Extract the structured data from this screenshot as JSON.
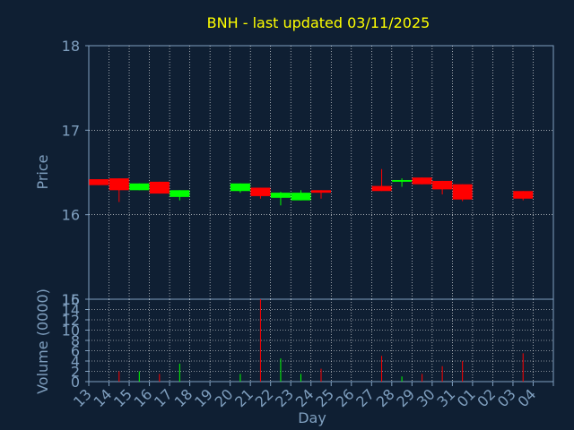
{
  "chart_data": [
    {
      "type": "candlestick",
      "title": "BNH - last updated 03/11/2025",
      "ylabel": "Price",
      "ylim": [
        15,
        18
      ],
      "yticks": [
        "18",
        "17",
        "16",
        "15"
      ],
      "grid": true,
      "colors": {
        "up": "#00ff00",
        "down": "#ff0000",
        "title": "#ffff00",
        "axis_text": "#7f9fbf",
        "background": "#0f1f33",
        "grid": "#ffffff"
      },
      "categories": [
        "13",
        "14",
        "15",
        "16",
        "17",
        "18",
        "19",
        "20",
        "21",
        "22",
        "23",
        "24",
        "25",
        "26",
        "27",
        "28",
        "29",
        "30",
        "31",
        "01",
        "02",
        "03",
        "04"
      ],
      "candles": [
        {
          "day": "13",
          "open": 16.42,
          "close": 16.35,
          "high": 16.42,
          "low": 16.35
        },
        {
          "day": "14",
          "open": 16.43,
          "close": 16.29,
          "high": 16.43,
          "low": 16.15
        },
        {
          "day": "15",
          "open": 16.29,
          "close": 16.37,
          "high": 16.37,
          "low": 16.29
        },
        {
          "day": "16",
          "open": 16.39,
          "close": 16.25,
          "high": 16.39,
          "low": 16.25
        },
        {
          "day": "17",
          "open": 16.21,
          "close": 16.29,
          "high": 16.29,
          "low": 16.17
        },
        {
          "day": "20",
          "open": 16.28,
          "close": 16.37,
          "high": 16.37,
          "low": 16.26
        },
        {
          "day": "21",
          "open": 16.32,
          "close": 16.22,
          "high": 16.32,
          "low": 16.19
        },
        {
          "day": "22",
          "open": 16.2,
          "close": 16.26,
          "high": 16.27,
          "low": 16.11
        },
        {
          "day": "23",
          "open": 16.17,
          "close": 16.26,
          "high": 16.29,
          "low": 16.17
        },
        {
          "day": "24",
          "open": 16.29,
          "close": 16.26,
          "high": 16.29,
          "low": 16.19
        },
        {
          "day": "27",
          "open": 16.34,
          "close": 16.28,
          "high": 16.54,
          "low": 16.28
        },
        {
          "day": "28",
          "open": 16.39,
          "close": 16.41,
          "high": 16.43,
          "low": 16.33
        },
        {
          "day": "29",
          "open": 16.44,
          "close": 16.36,
          "high": 16.44,
          "low": 16.36
        },
        {
          "day": "30",
          "open": 16.4,
          "close": 16.3,
          "high": 16.4,
          "low": 16.24
        },
        {
          "day": "31",
          "open": 16.36,
          "close": 16.18,
          "high": 16.36,
          "low": 16.16
        },
        {
          "day": "03",
          "open": 16.28,
          "close": 16.19,
          "high": 16.28,
          "low": 16.17
        }
      ]
    },
    {
      "type": "bar",
      "ylabel": "Volume (0000)",
      "xlabel": "Day",
      "ylim": [
        0,
        16
      ],
      "yticks": [
        "16",
        "14",
        "12",
        "10",
        "8",
        "6",
        "4",
        "2",
        "0"
      ],
      "grid": true,
      "categories": [
        "13",
        "14",
        "15",
        "16",
        "17",
        "18",
        "19",
        "20",
        "21",
        "22",
        "23",
        "24",
        "25",
        "26",
        "27",
        "28",
        "29",
        "30",
        "31",
        "01",
        "02",
        "03",
        "04"
      ],
      "bars": [
        {
          "day": "14",
          "value": 2.0,
          "dir": "down"
        },
        {
          "day": "15",
          "value": 2.0,
          "dir": "up"
        },
        {
          "day": "16",
          "value": 1.5,
          "dir": "down"
        },
        {
          "day": "17",
          "value": 3.5,
          "dir": "up"
        },
        {
          "day": "20",
          "value": 1.5,
          "dir": "up"
        },
        {
          "day": "21",
          "value": 16.0,
          "dir": "down"
        },
        {
          "day": "22",
          "value": 4.5,
          "dir": "up"
        },
        {
          "day": "23",
          "value": 1.5,
          "dir": "up"
        },
        {
          "day": "24",
          "value": 2.5,
          "dir": "down"
        },
        {
          "day": "27",
          "value": 5.0,
          "dir": "down"
        },
        {
          "day": "28",
          "value": 1.0,
          "dir": "up"
        },
        {
          "day": "29",
          "value": 1.5,
          "dir": "down"
        },
        {
          "day": "30",
          "value": 3.0,
          "dir": "down"
        },
        {
          "day": "31",
          "value": 4.0,
          "dir": "down"
        },
        {
          "day": "03",
          "value": 5.5,
          "dir": "down"
        }
      ]
    }
  ]
}
